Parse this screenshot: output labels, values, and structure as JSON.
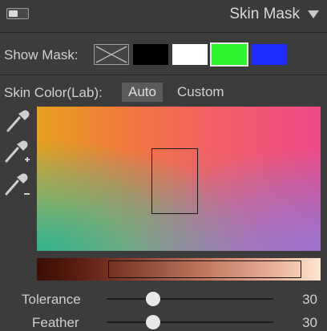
{
  "panel": {
    "title": "Skin Mask",
    "toggle_icon": "panel-toggle-icon",
    "collapse_icon": "triangle-down-icon"
  },
  "show_mask": {
    "label": "Show Mask:",
    "options": [
      {
        "name": "none",
        "color": "#444444"
      },
      {
        "name": "black",
        "color": "#000000"
      },
      {
        "name": "white",
        "color": "#ffffff"
      },
      {
        "name": "green",
        "color": "#2df52d"
      },
      {
        "name": "blue",
        "color": "#1f2cff"
      }
    ],
    "selected": "green"
  },
  "skin_color": {
    "label": "Skin Color(Lab):",
    "modes": [
      "Auto",
      "Custom"
    ],
    "active_mode": "Auto",
    "tools": [
      "eyedropper-icon",
      "eyedropper-add-icon",
      "eyedropper-subtract-icon"
    ]
  },
  "sliders": [
    {
      "label": "Tolerance",
      "value": "30",
      "fraction": 0.28
    },
    {
      "label": "Feather",
      "value": "30",
      "fraction": 0.28
    }
  ]
}
